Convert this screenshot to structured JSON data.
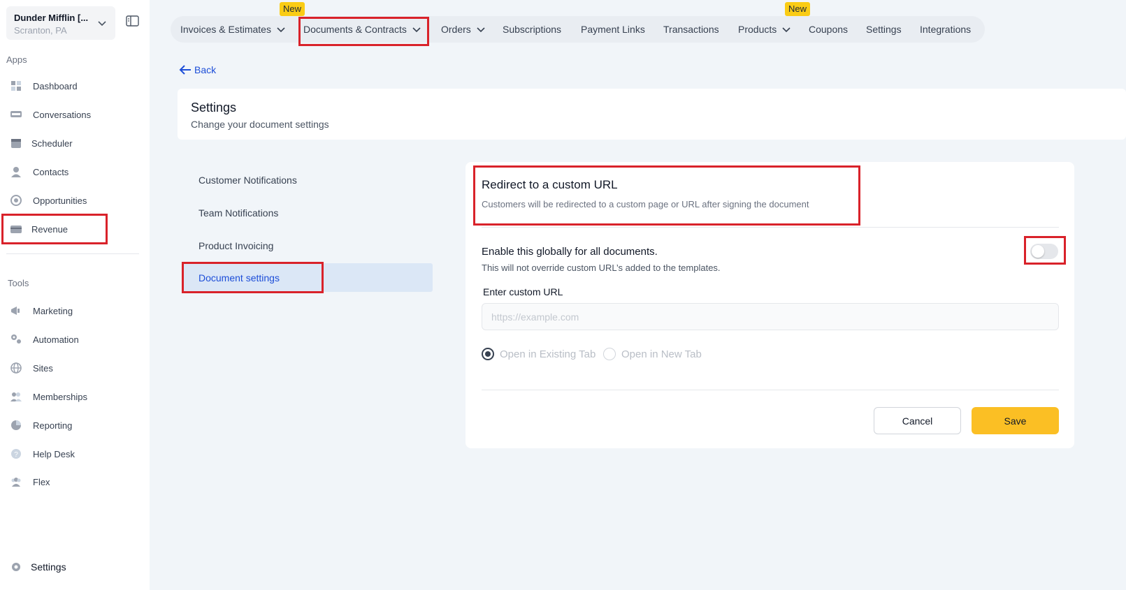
{
  "sidebar": {
    "account_name": "Dunder Mifflin [...",
    "account_location": "Scranton, PA",
    "apps_label": "Apps",
    "apps": [
      {
        "label": "Dashboard",
        "icon": "dashboard-icon"
      },
      {
        "label": "Conversations",
        "icon": "chat-icon"
      },
      {
        "label": "Scheduler",
        "icon": "calendar-icon"
      },
      {
        "label": "Contacts",
        "icon": "person-icon"
      },
      {
        "label": "Opportunities",
        "icon": "target-icon"
      },
      {
        "label": "Revenue",
        "icon": "credit-card-icon"
      }
    ],
    "tools_label": "Tools",
    "tools": [
      {
        "label": "Marketing",
        "icon": "megaphone-icon"
      },
      {
        "label": "Automation",
        "icon": "gears-icon"
      },
      {
        "label": "Sites",
        "icon": "globe-icon"
      },
      {
        "label": "Memberships",
        "icon": "users-icon"
      },
      {
        "label": "Reporting",
        "icon": "pie-chart-icon"
      },
      {
        "label": "Help Desk",
        "icon": "help-icon"
      },
      {
        "label": "Flex",
        "icon": "team-icon"
      }
    ],
    "settings_label": "Settings"
  },
  "topnav": {
    "tabs": [
      {
        "label": "Invoices & Estimates",
        "dropdown": true
      },
      {
        "label": "Documents & Contracts",
        "dropdown": true
      },
      {
        "label": "Orders",
        "dropdown": true
      },
      {
        "label": "Subscriptions",
        "dropdown": false
      },
      {
        "label": "Payment Links",
        "dropdown": false
      },
      {
        "label": "Transactions",
        "dropdown": false
      },
      {
        "label": "Products",
        "dropdown": true
      },
      {
        "label": "Coupons",
        "dropdown": false
      },
      {
        "label": "Settings",
        "dropdown": false
      },
      {
        "label": "Integrations",
        "dropdown": false
      }
    ],
    "new_badge": "New"
  },
  "back_label": "Back",
  "header": {
    "title": "Settings",
    "subtitle": "Change your document settings"
  },
  "settings_menu": [
    "Customer Notifications",
    "Team Notifications",
    "Product Invoicing",
    "Document settings"
  ],
  "card": {
    "title": "Redirect to a custom URL",
    "description": "Customers will be redirected to a custom page or URL after signing the document",
    "enable_title": "Enable this globally for all documents.",
    "enable_subtitle": "This will not override custom URL’s added to the templates.",
    "toggle_on": false,
    "url_label": "Enter custom URL",
    "url_value": "",
    "url_placeholder": "https://example.com",
    "radio_existing": "Open in Existing Tab",
    "radio_new": "Open in New Tab",
    "selected_radio": "existing",
    "cancel_label": "Cancel",
    "save_label": "Save"
  },
  "colors": {
    "accent_blue": "#1d4ed8",
    "save_yellow": "#fbbf24",
    "highlight_red": "#d9222a",
    "badge_yellow": "#facc15"
  }
}
